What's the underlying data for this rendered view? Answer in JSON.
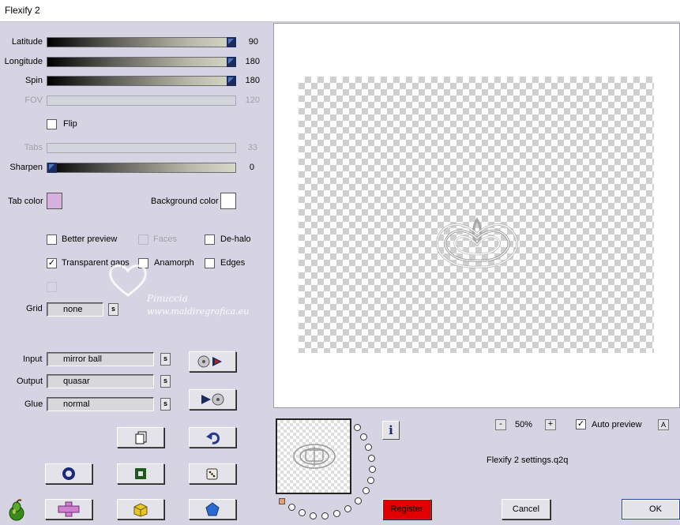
{
  "window": {
    "title": "Flexify 2"
  },
  "sliders": [
    {
      "label": "Latitude",
      "value": "90",
      "level": 1.0,
      "enabled": true
    },
    {
      "label": "Longitude",
      "value": "180",
      "level": 1.0,
      "enabled": true
    },
    {
      "label": "Spin",
      "value": "180",
      "level": 1.0,
      "enabled": true
    },
    {
      "label": "FOV",
      "value": "120",
      "enabled": false
    },
    {
      "label": "Tabs",
      "value": "33",
      "enabled": false
    },
    {
      "label": "Sharpen",
      "value": "0",
      "level": 0.0,
      "enabled": true
    }
  ],
  "flip": {
    "label": "Flip",
    "checked": false
  },
  "tab_color": {
    "label": "Tab color",
    "color": "#d8b0e0"
  },
  "background_color": {
    "label": "Background color",
    "color": "#ffffff"
  },
  "options": {
    "better_preview": {
      "label": "Better preview",
      "checked": false
    },
    "faces": {
      "label": "Faces",
      "checked": false,
      "enabled": false
    },
    "de_halo": {
      "label": "De-halo",
      "checked": false
    },
    "transparent_gaps": {
      "label": "Transparent gaps",
      "checked": true
    },
    "anamorph": {
      "label": "Anamorph",
      "checked": false
    },
    "edges": {
      "label": "Edges",
      "checked": false
    }
  },
  "grid": {
    "label": "Grid",
    "value": "none"
  },
  "projection": {
    "input": {
      "label": "Input",
      "value": "mirror ball"
    },
    "output": {
      "label": "Output",
      "value": "quasar"
    },
    "glue": {
      "label": "Glue",
      "value": "normal"
    },
    "s_label": "s"
  },
  "watermark": {
    "name": "Pinuccia",
    "url": "www.maldiregrafica.eu"
  },
  "zoom": {
    "value": "50%",
    "minus": "-",
    "plus": "+"
  },
  "auto_preview": {
    "label": "Auto preview",
    "checked": true,
    "button": "A"
  },
  "settings_file": "Flexify 2 settings.q2q",
  "info_label": "i",
  "buttons": {
    "register": "Register",
    "cancel": "Cancel",
    "ok": "OK"
  },
  "colors": {
    "accent": "#e00000",
    "panel": "#d6d4e2",
    "tab_swatch": "#d8b0e0"
  }
}
